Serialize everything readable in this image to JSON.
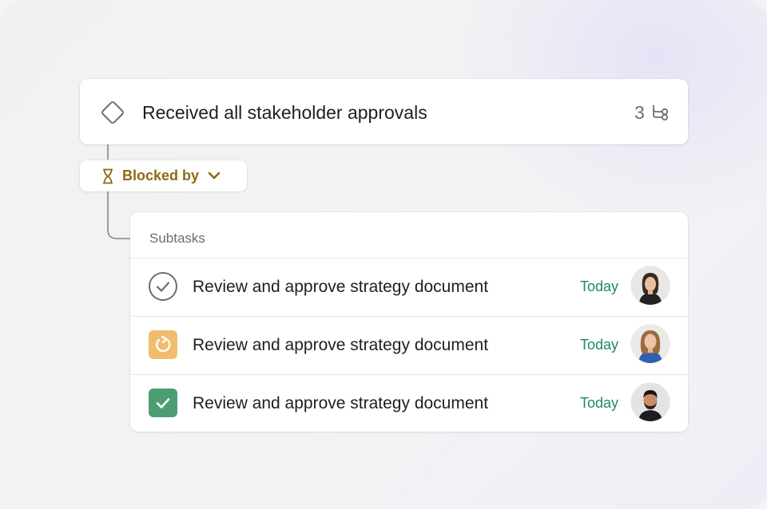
{
  "milestone": {
    "title": "Received all stakeholder approvals",
    "subtask_count": "3",
    "icon": "diamond-icon"
  },
  "blocked": {
    "label": "Blocked by",
    "icon": "hourglass-icon",
    "color": "#8c6b16"
  },
  "subtasks": {
    "header": "Subtasks",
    "rows": [
      {
        "name": "Review and approve strategy document",
        "due": "Today",
        "status": "incomplete-check"
      },
      {
        "name": "Review and approve strategy document",
        "due": "Today",
        "status": "in-progress"
      },
      {
        "name": "Review and approve strategy document",
        "due": "Today",
        "status": "complete"
      }
    ]
  },
  "colors": {
    "due": "#1f8a5c",
    "in_progress": "#f0bd6e",
    "complete": "#4d9d73"
  }
}
